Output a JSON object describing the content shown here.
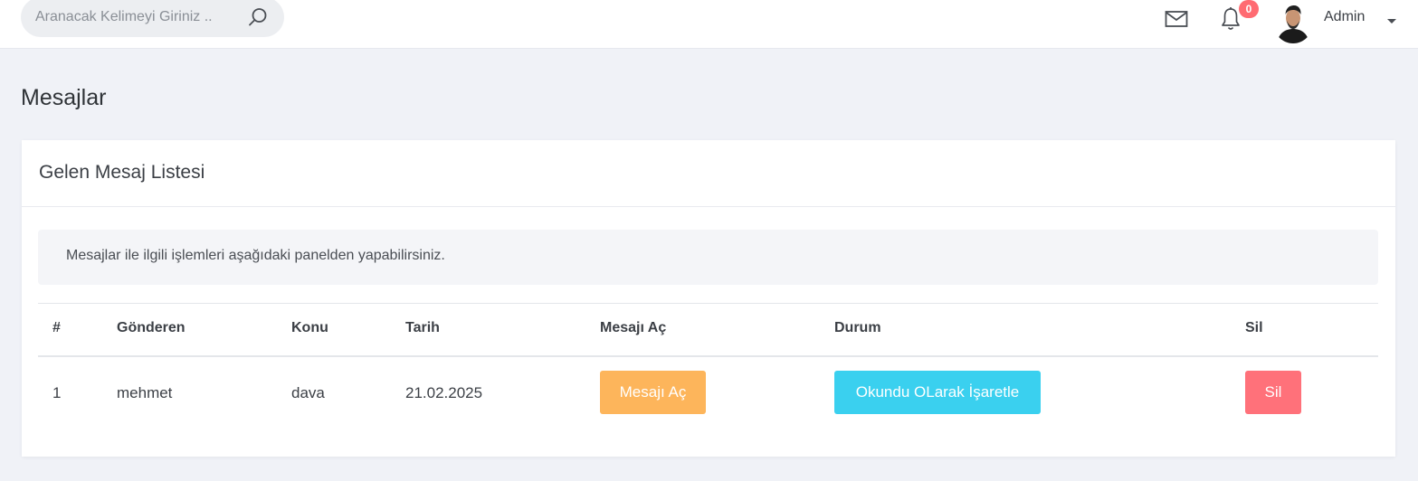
{
  "search": {
    "placeholder": "Aranacak Kelimeyi Giriniz .."
  },
  "header": {
    "mail_icon": "mail-icon",
    "bell_icon": "bell-icon",
    "notification_count": "0",
    "user_name": "Admin",
    "badge_color": "#ff6b72"
  },
  "page": {
    "title": "Mesajlar"
  },
  "card": {
    "title": "Gelen Mesaj Listesi",
    "info": "Mesajlar ile ilgili işlemleri aşağıdaki panelden yapabilirsiniz."
  },
  "table": {
    "headers": [
      "#",
      "Gönderen",
      "Konu",
      "Tarih",
      "Mesajı Aç",
      "Durum",
      "Sil"
    ],
    "rows": [
      {
        "no": "1",
        "sender": "mehmet",
        "subject": "dava",
        "date": "21.02.2025",
        "open_label": "Mesajı Aç",
        "status_label": "Okundu OLarak İşaretle",
        "delete_label": "Sil"
      }
    ]
  },
  "colors": {
    "open_button": "#fdb55b",
    "status_button": "#3ad0ef",
    "delete_button": "#ff717a"
  }
}
